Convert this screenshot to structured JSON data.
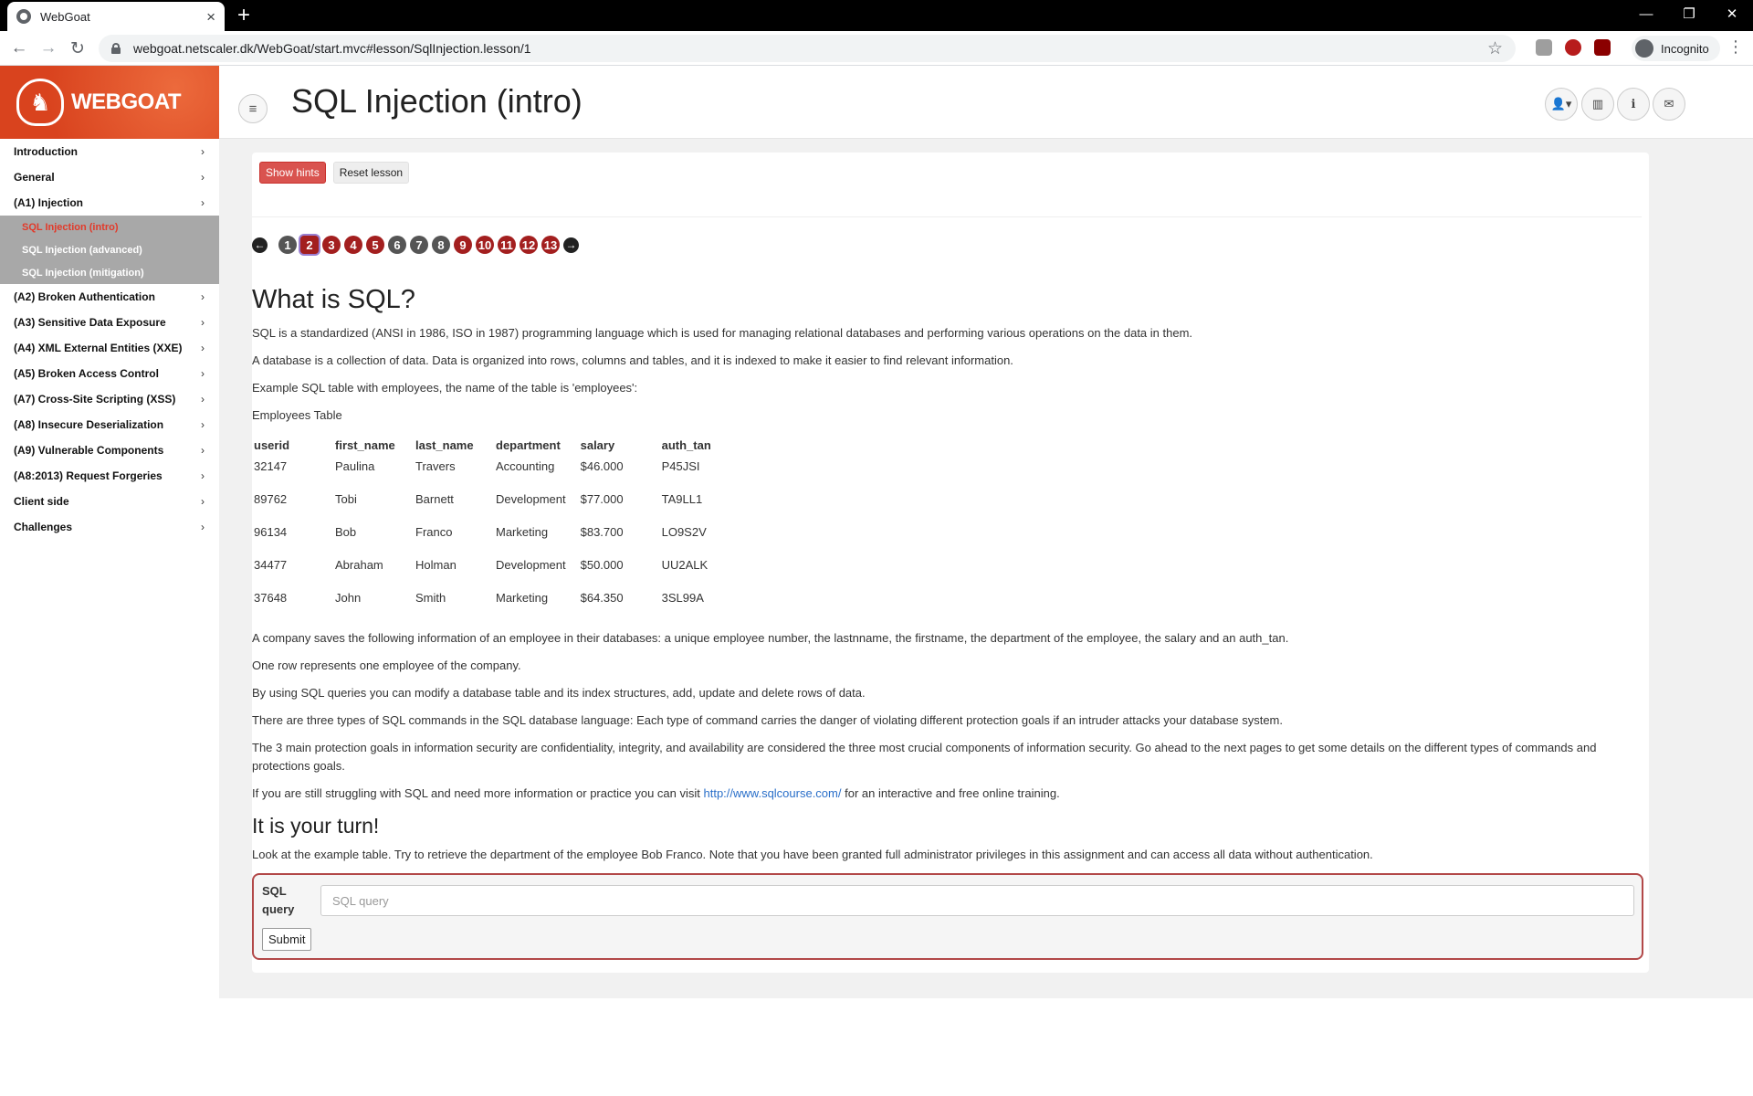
{
  "browser": {
    "tab_title": "WebGoat",
    "url": "webgoat.netscaler.dk/WebGoat/start.mvc#lesson/SqlInjection.lesson/1",
    "incognito_label": "Incognito"
  },
  "logo": {
    "brand_bold": "WEB",
    "brand_light": "GOAT"
  },
  "sidebar": {
    "items_top": [
      {
        "label": "Introduction"
      },
      {
        "label": "General"
      },
      {
        "label": "(A1) Injection"
      }
    ],
    "subitems": [
      {
        "label": "SQL Injection (intro)"
      },
      {
        "label": "SQL Injection (advanced)"
      },
      {
        "label": "SQL Injection (mitigation)"
      }
    ],
    "items_bottom": [
      {
        "label": "(A2) Broken Authentication"
      },
      {
        "label": "(A3) Sensitive Data Exposure"
      },
      {
        "label": "(A4) XML External Entities (XXE)"
      },
      {
        "label": "(A5) Broken Access Control"
      },
      {
        "label": "(A7) Cross-Site Scripting (XSS)"
      },
      {
        "label": "(A8) Insecure Deserialization"
      },
      {
        "label": "(A9) Vulnerable Components"
      },
      {
        "label": "(A8:2013) Request Forgeries"
      },
      {
        "label": "Client side"
      },
      {
        "label": "Challenges"
      }
    ]
  },
  "header": {
    "title": "SQL Injection (intro)"
  },
  "lesson": {
    "show_hints": "Show hints",
    "reset_lesson": "Reset lesson",
    "pages": [
      "1",
      "2",
      "3",
      "4",
      "5",
      "6",
      "7",
      "8",
      "9",
      "10",
      "11",
      "12",
      "13"
    ]
  },
  "content": {
    "h_what": "What is SQL?",
    "p1": "SQL is a standardized (ANSI in 1986, ISO in 1987) programming language which is used for managing relational databases and performing various operations on the data in them.",
    "p2": "A database is a collection of data. Data is organized into rows, columns and tables, and it is indexed to make it easier to find relevant information.",
    "p3": "Example SQL table with employees, the name of the table is 'employees':",
    "table_caption": "Employees Table",
    "table": {
      "headers": [
        "userid",
        "first_name",
        "last_name",
        "department",
        "salary",
        "auth_tan"
      ],
      "rows": [
        [
          "32147",
          "Paulina",
          "Travers",
          "Accounting",
          "$46.000",
          "P45JSI"
        ],
        [
          "89762",
          "Tobi",
          "Barnett",
          "Development",
          "$77.000",
          "TA9LL1"
        ],
        [
          "96134",
          "Bob",
          "Franco",
          "Marketing",
          "$83.700",
          "LO9S2V"
        ],
        [
          "34477",
          "Abraham",
          "Holman",
          "Development",
          "$50.000",
          "UU2ALK"
        ],
        [
          "37648",
          "John",
          "Smith",
          "Marketing",
          "$64.350",
          "3SL99A"
        ]
      ]
    },
    "p4": "A company saves the following information of an employee in their databases: a unique employee number, the lastnname, the firstname, the department of the employee, the salary and an auth_tan.",
    "p5": "One row represents one employee of the company.",
    "p6": "By using SQL queries you can modify a database table and its index structures, add, update and delete rows of data.",
    "p7": "There are three types of SQL commands in the SQL database language: Each type of command carries the danger of violating different protection goals if an intruder attacks your database system.",
    "p8": "The 3 main protection goals in information security are confidentiality, integrity, and availability are considered the three most crucial components of information security. Go ahead to the next pages to get some details on the different types of commands and protections goals.",
    "p9_before": "If you are still struggling with SQL and need more information or practice you can visit ",
    "p9_link": "http://www.sqlcourse.com/",
    "p9_after": " for an interactive and free online training.",
    "h_turn": "It is your turn!",
    "p10": "Look at the example table. Try to retrieve the department of the employee Bob Franco. Note that you have been granted full administrator privileges in this assignment and can access all data without authentication."
  },
  "form": {
    "label_line1": "SQL",
    "label_line2": "query",
    "placeholder": "SQL query",
    "value": "",
    "submit": "Submit"
  }
}
